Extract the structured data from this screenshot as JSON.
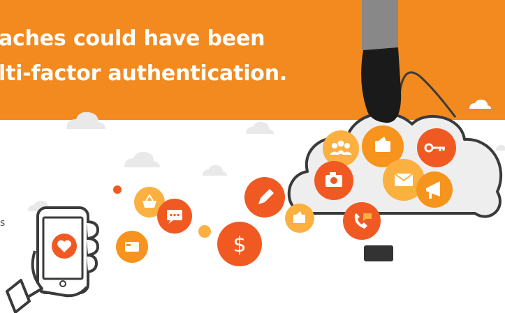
{
  "headline": {
    "line1": "aches could have been",
    "line2": "lti-factor authentication."
  },
  "edge_glyph": "s",
  "colors": {
    "banner": "#f28a1f",
    "orange_dark": "#f05a22",
    "orange_mid": "#f7941d",
    "orange_light": "#fbb040",
    "cloud_fill": "#eeeeee",
    "outline": "#3a3a3a"
  },
  "icons": [
    "people-icon",
    "wallet-icon",
    "key-icon",
    "camera-icon",
    "envelope-icon",
    "megaphone-icon",
    "pencil-icon",
    "phone-icon",
    "basket-icon",
    "chat-icon",
    "dollar-icon",
    "card-icon",
    "heart-icon",
    "hand-icon",
    "smartphone-icon"
  ]
}
